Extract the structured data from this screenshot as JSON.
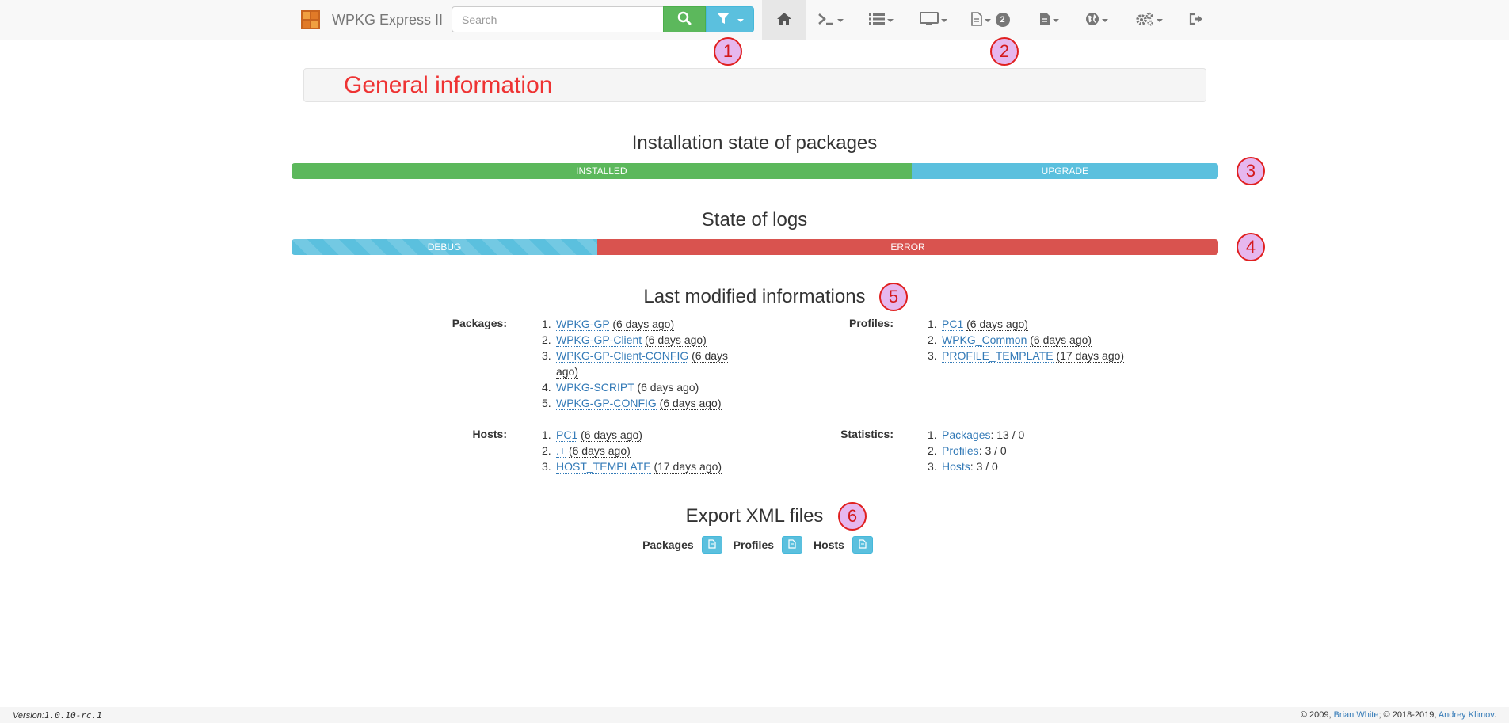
{
  "navbar": {
    "brand": "WPKG Express II",
    "search_placeholder": "Search",
    "badge_count": "2",
    "items": [
      "home-icon",
      "terminal-icon",
      "list-icon",
      "monitor-icon",
      "file-icon",
      "file-solid-icon",
      "globe-icon",
      "cogs-icon",
      "sign-out-icon"
    ]
  },
  "callouts": [
    "1",
    "2",
    "3",
    "4",
    "5",
    "6"
  ],
  "page": {
    "title": "General information"
  },
  "packages_state": {
    "heading": "Installation state of packages",
    "segments": [
      {
        "label": "INSTALLED",
        "fraction": 0.669,
        "color": "#5cb85c"
      },
      {
        "label": "UPGRADE",
        "fraction": 0.331,
        "color": "#5bc0de"
      }
    ]
  },
  "logs_state": {
    "heading": "State of logs",
    "segments": [
      {
        "label": "DEBUG",
        "fraction": 0.33,
        "color": "#5bc0de"
      },
      {
        "label": "ERROR",
        "fraction": 0.67,
        "color": "#d9534f"
      }
    ]
  },
  "last_modified": {
    "heading": "Last modified informations",
    "packages_label": "Packages:",
    "packages": [
      {
        "num": "1.",
        "name": "WPKG-GP",
        "ago": "(6 days ago)"
      },
      {
        "num": "2.",
        "name": "WPKG-GP-Client",
        "ago": "(6 days ago)"
      },
      {
        "num": "3.",
        "name": "WPKG-GP-Client-CONFIG",
        "ago": "(6 days ago)"
      },
      {
        "num": "4.",
        "name": "WPKG-SCRIPT",
        "ago": "(6 days ago)"
      },
      {
        "num": "5.",
        "name": "WPKG-GP-CONFIG",
        "ago": "(6 days ago)"
      }
    ],
    "profiles_label": "Profiles:",
    "profiles": [
      {
        "num": "1.",
        "name": "PC1",
        "ago": "(6 days ago)"
      },
      {
        "num": "2.",
        "name": "WPKG_Common",
        "ago": "(6 days ago)"
      },
      {
        "num": "3.",
        "name": "PROFILE_TEMPLATE",
        "ago": "(17 days ago)"
      }
    ],
    "hosts_label": "Hosts:",
    "hosts": [
      {
        "num": "1.",
        "name": "PC1",
        "ago": "(6 days ago)"
      },
      {
        "num": "2.",
        "name": ".+",
        "ago": "(6 days ago)"
      },
      {
        "num": "3.",
        "name": "HOST_TEMPLATE",
        "ago": "(17 days ago)"
      }
    ],
    "statistics_label": "Statistics:",
    "statistics": [
      {
        "num": "1.",
        "name": "Packages",
        "value": ": 13 / 0"
      },
      {
        "num": "2.",
        "name": "Profiles",
        "value": ": 3 / 0"
      },
      {
        "num": "3.",
        "name": "Hosts",
        "value": ": 3 / 0"
      }
    ]
  },
  "export": {
    "heading": "Export XML files",
    "items": [
      "Packages",
      "Profiles",
      "Hosts"
    ]
  },
  "footer": {
    "version_label": "Version:",
    "version": "1.0.10-rc.1",
    "copyright_1": "© 2009,",
    "author_1": "Brian White",
    "copyright_2": "; © 2018-2019,",
    "author_2": "Andrey Klimov",
    "end": "."
  }
}
